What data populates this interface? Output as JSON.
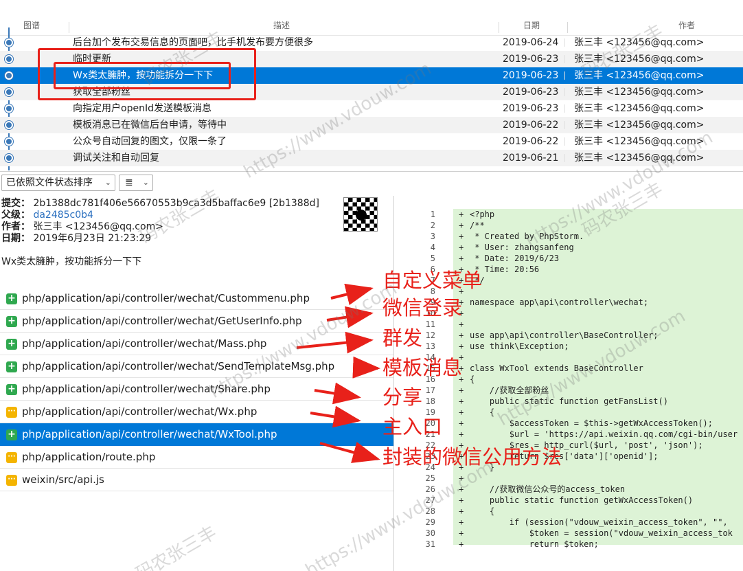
{
  "log": {
    "headers": {
      "graph": "图谱",
      "description": "描述",
      "date": "日期",
      "author": "作者"
    },
    "commits": [
      {
        "message": "后台加个发布交易信息的页面吧，比手机发布要方便很多",
        "date": "2019-06-24",
        "author": "张三丰 <123456@qq.com>"
      },
      {
        "message": "临时更新",
        "date": "2019-06-23",
        "author": "张三丰 <123456@qq.com>"
      },
      {
        "message": "Wx类太臃肿，按功能拆分一下下",
        "date": "2019-06-23",
        "author": "张三丰 <123456@qq.com>"
      },
      {
        "message": "获取全部粉丝",
        "date": "2019-06-23",
        "author": "张三丰 <123456@qq.com>"
      },
      {
        "message": "向指定用户openId发送模板消息",
        "date": "2019-06-23",
        "author": "张三丰 <123456@qq.com>"
      },
      {
        "message": "模板消息已在微信后台申请，等待中",
        "date": "2019-06-22",
        "author": "张三丰 <123456@qq.com>"
      },
      {
        "message": "公众号自动回复的图文，仅限一条了",
        "date": "2019-06-22",
        "author": "张三丰 <123456@qq.com>"
      },
      {
        "message": "调试关注和自动回复",
        "date": "2019-06-21",
        "author": "张三丰 <123456@qq.com>"
      }
    ]
  },
  "toolbar": {
    "sort_label": "已依照文件状态排序",
    "chevron": "⌄",
    "view_icon": "≣"
  },
  "details": {
    "commit_key": "提交：",
    "commit_value": "2b1388dc781f406e56670553b9ca3d5baffac6e9 [2b1388d]",
    "parent_key": "父级：",
    "parent_value": "da2485c0b4",
    "author_key": "作者：",
    "author_value": "张三丰 <123456@qq.com>",
    "date_key": "日期：",
    "date_value": "2019年6月23日 21:23:29",
    "message": "Wx类太臃肿，按功能拆分一下下"
  },
  "files": [
    {
      "path": "php/application/api/controller/wechat/Custommenu.php",
      "status": "added",
      "status_glyph": "+"
    },
    {
      "path": "php/application/api/controller/wechat/GetUserInfo.php",
      "status": "added",
      "status_glyph": "+"
    },
    {
      "path": "php/application/api/controller/wechat/Mass.php",
      "status": "added",
      "status_glyph": "+"
    },
    {
      "path": "php/application/api/controller/wechat/SendTemplateMsg.php",
      "status": "added",
      "status_glyph": "+"
    },
    {
      "path": "php/application/api/controller/wechat/Share.php",
      "status": "added",
      "status_glyph": "+"
    },
    {
      "path": "php/application/api/controller/wechat/Wx.php",
      "status": "modified",
      "status_glyph": "···"
    },
    {
      "path": "php/application/api/controller/wechat/WxTool.php",
      "status": "added",
      "status_glyph": "+"
    },
    {
      "path": "php/application/route.php",
      "status": "modified",
      "status_glyph": "···"
    },
    {
      "path": "weixin/src/api.js",
      "status": "modified",
      "status_glyph": "···"
    }
  ],
  "diff": {
    "plus": "+",
    "lines": [
      {
        "n": "1",
        "code": "<?php"
      },
      {
        "n": "2",
        "code": "/**"
      },
      {
        "n": "3",
        "code": " * Created by PhpStorm."
      },
      {
        "n": "4",
        "code": " * User: zhangsanfeng"
      },
      {
        "n": "5",
        "code": " * Date: 2019/6/23"
      },
      {
        "n": "6",
        "code": " * Time: 20:56"
      },
      {
        "n": "7",
        "code": " */"
      },
      {
        "n": "8",
        "code": ""
      },
      {
        "n": "9",
        "code": "namespace app\\api\\controller\\wechat;"
      },
      {
        "n": "10",
        "code": ""
      },
      {
        "n": "11",
        "code": ""
      },
      {
        "n": "12",
        "code": "use app\\api\\controller\\BaseController;"
      },
      {
        "n": "13",
        "code": "use think\\Exception;"
      },
      {
        "n": "14",
        "code": ""
      },
      {
        "n": "15",
        "code": "class WxTool extends BaseController"
      },
      {
        "n": "16",
        "code": "{"
      },
      {
        "n": "17",
        "code": "    //获取全部粉丝"
      },
      {
        "n": "18",
        "code": "    public static function getFansList()"
      },
      {
        "n": "19",
        "code": "    {"
      },
      {
        "n": "20",
        "code": "        $accessToken = $this->getWxAccessToken();"
      },
      {
        "n": "21",
        "code": "        $url = 'https://api.weixin.qq.com/cgi-bin/user"
      },
      {
        "n": "22",
        "code": "        $res = http_curl($url, 'post', 'json');"
      },
      {
        "n": "23",
        "code": "        return $res['data']['openid'];"
      },
      {
        "n": "24",
        "code": "    }"
      },
      {
        "n": "25",
        "code": ""
      },
      {
        "n": "26",
        "code": "    //获取微信公众号的access_token"
      },
      {
        "n": "27",
        "code": "    public static function getWxAccessToken()"
      },
      {
        "n": "28",
        "code": "    {"
      },
      {
        "n": "29",
        "code": "        if (session(\"vdouw_weixin_access_token\", \"\","
      },
      {
        "n": "30",
        "code": "            $token = session(\"vdouw_weixin_access_tok"
      },
      {
        "n": "31",
        "code": "            return $token;"
      }
    ]
  },
  "annotations": {
    "labels": [
      "自定义菜单",
      "微信登录",
      "群发",
      "模板消息",
      "分享",
      "主入口",
      "封装的微信公用方法"
    ],
    "color": "#e8211a"
  },
  "watermark": {
    "texts": [
      "码农张三丰",
      "https://www.vdouw.com",
      "码农张三丰",
      "https://www.vdouw.com",
      "码农张三丰",
      "https://www.vdouw.com",
      "码农张三丰",
      "https://www.vdouw.com",
      "码农张三丰",
      "https://www.vdouw.com"
    ]
  },
  "colors": {
    "selection": "#0078d7",
    "added": "#2fa84f",
    "modified": "#f4b400",
    "diff_added_bg": "#ddf3d6",
    "graph": "#3a78b8"
  }
}
